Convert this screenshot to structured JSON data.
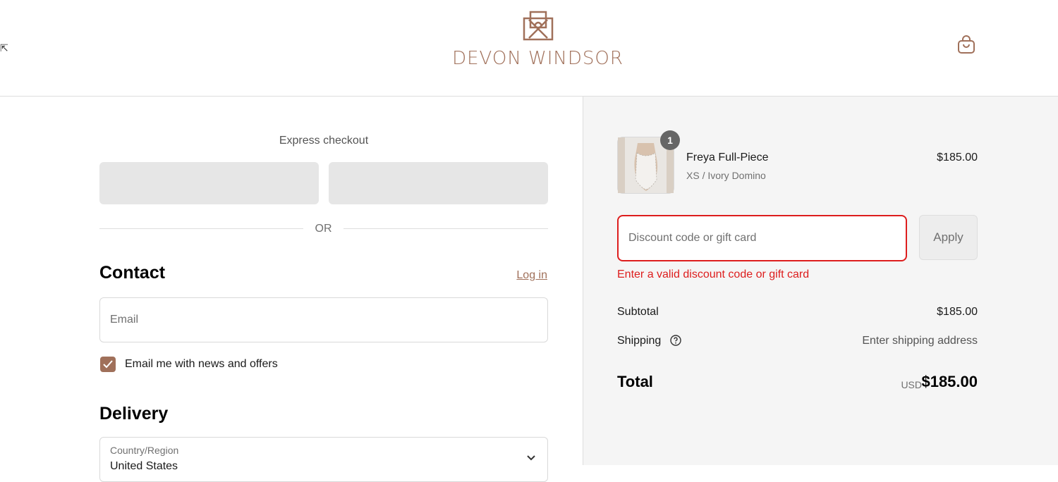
{
  "header": {
    "brand": "DEVON WINDSOR"
  },
  "express": {
    "title": "Express checkout",
    "or_label": "OR"
  },
  "contact": {
    "title": "Contact",
    "login_label": "Log in",
    "email_placeholder": "Email",
    "newsletter_label": "Email me with news and offers",
    "newsletter_checked": true
  },
  "delivery": {
    "title": "Delivery",
    "country_label": "Country/Region",
    "country_value": "United States"
  },
  "summary": {
    "item": {
      "quantity": "1",
      "name": "Freya Full-Piece",
      "variant": "XS / Ivory Domino",
      "price": "$185.00"
    },
    "discount_placeholder": "Discount code or gift card",
    "apply_label": "Apply",
    "discount_error": "Enter a valid discount code or gift card",
    "subtotal_label": "Subtotal",
    "subtotal_value": "$185.00",
    "shipping_label": "Shipping",
    "shipping_value": "Enter shipping address",
    "total_label": "Total",
    "currency": "USD",
    "total_value": "$185.00"
  },
  "colors": {
    "accent": "#a0705a",
    "error": "#dd1d1d",
    "summary_bg": "#f5f5f5"
  }
}
